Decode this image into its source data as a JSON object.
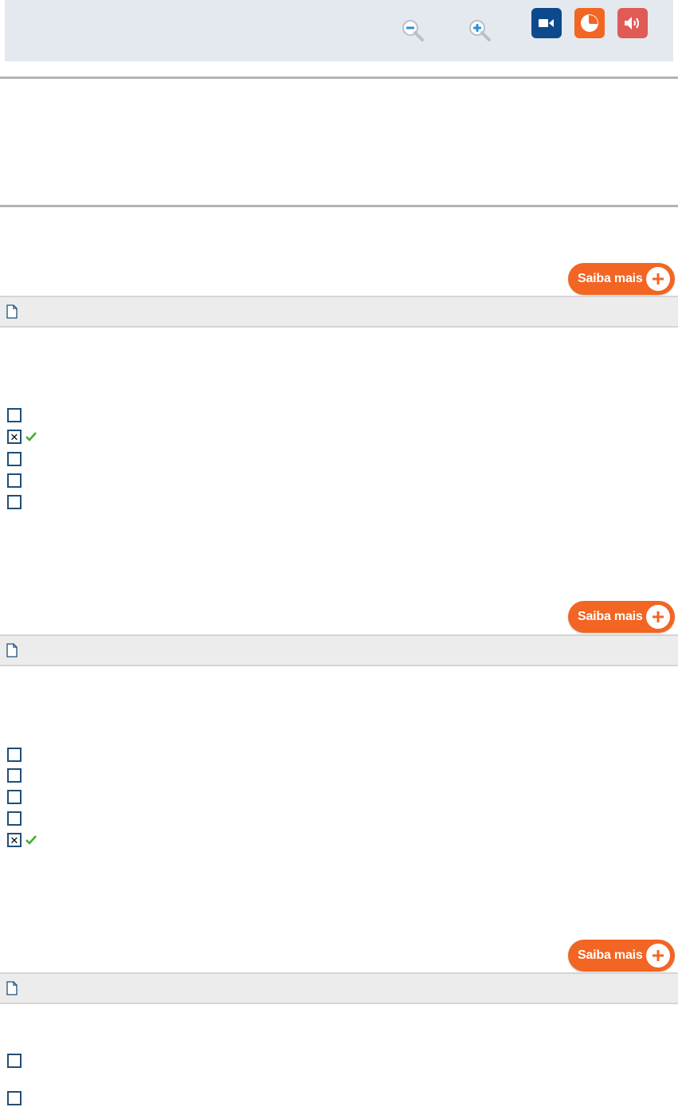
{
  "toolbar": {
    "icons": [
      "zoom-out-icon",
      "zoom-in-icon",
      "video-icon",
      "pie-chart-icon",
      "speaker-icon"
    ],
    "colors": {
      "video": "#0d4a8c",
      "chart": "#f26522",
      "audio": "#e05a56",
      "background": "#e3e9ee"
    }
  },
  "questions": [
    {
      "saiba_label": "Saiba mais",
      "options": [
        {
          "checked": false,
          "correct": false,
          "mark": ""
        },
        {
          "checked": true,
          "correct": true,
          "mark": "✕"
        },
        {
          "checked": false,
          "correct": false,
          "mark": ""
        },
        {
          "checked": false,
          "correct": false,
          "mark": ""
        },
        {
          "checked": false,
          "correct": false,
          "mark": ""
        }
      ]
    },
    {
      "saiba_label": "Saiba mais",
      "options": [
        {
          "checked": false,
          "correct": false,
          "mark": ""
        },
        {
          "checked": false,
          "correct": false,
          "mark": ""
        },
        {
          "checked": false,
          "correct": false,
          "mark": ""
        },
        {
          "checked": false,
          "correct": false,
          "mark": ""
        },
        {
          "checked": true,
          "correct": true,
          "mark": "✕"
        }
      ]
    },
    {
      "saiba_label": "Saiba mais",
      "options": [
        {
          "checked": false,
          "correct": false,
          "mark": ""
        },
        {
          "checked": false,
          "correct": false,
          "mark": ""
        }
      ]
    }
  ],
  "accent": {
    "orange": "#f26522",
    "correct_green": "#3fae29",
    "checkbox_border": "#1f4e79"
  }
}
